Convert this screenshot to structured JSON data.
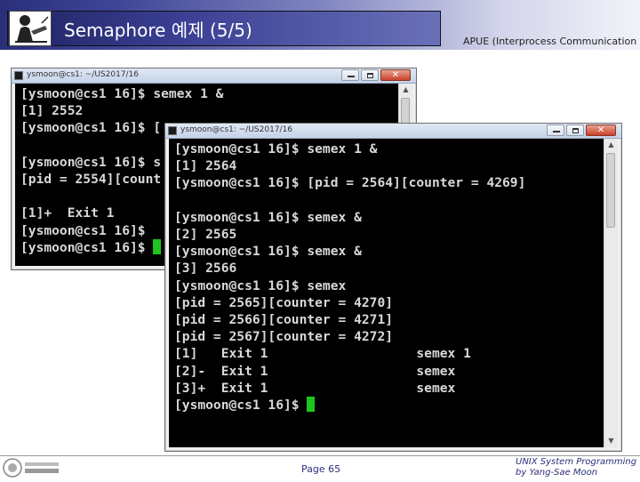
{
  "slide": {
    "title": "Semaphore 예제 (5/5)",
    "subtitle": "APUE (Interprocess Communication",
    "page": "Page 65",
    "credit_line1": "UNIX System Programming",
    "credit_line2": "by Yang-Sae Moon"
  },
  "window1": {
    "title": "ysmoon@cs1: ~/US2017/16",
    "lines": [
      "[ysmoon@cs1 16]$ semex 1 &",
      "[1] 2552",
      "[ysmoon@cs1 16]$ [",
      "",
      "[ysmoon@cs1 16]$ s",
      "[pid = 2554][count",
      "",
      "[1]+  Exit 1",
      "[ysmoon@cs1 16]$",
      "[ysmoon@cs1 16]$ "
    ]
  },
  "window2": {
    "title": "ysmoon@cs1: ~/US2017/16",
    "lines": [
      "[ysmoon@cs1 16]$ semex 1 &",
      "[1] 2564",
      "[ysmoon@cs1 16]$ [pid = 2564][counter = 4269]",
      "",
      "[ysmoon@cs1 16]$ semex &",
      "[2] 2565",
      "[ysmoon@cs1 16]$ semex &",
      "[3] 2566",
      "[ysmoon@cs1 16]$ semex",
      "[pid = 2565][counter = 4270]",
      "[pid = 2566][counter = 4271]",
      "[pid = 2567][counter = 4272]",
      "[1]   Exit 1                   semex 1",
      "[2]-  Exit 1                   semex",
      "[3]+  Exit 1                   semex",
      "[ysmoon@cs1 16]$ "
    ]
  },
  "window_controls": {
    "minimize": "–",
    "maximize": "□",
    "close": "✕"
  },
  "icons": {
    "header_logo": "person-at-desk-icon",
    "app": "terminal-icon",
    "footer_logo": "university-seal-icon",
    "scroll_up": "▲",
    "scroll_down": "▼"
  },
  "colors": {
    "terminal_bg": "#000000",
    "terminal_text": "#d8d8d8",
    "cursor": "#1ec51e",
    "header_dark": "#2a2f7a"
  }
}
